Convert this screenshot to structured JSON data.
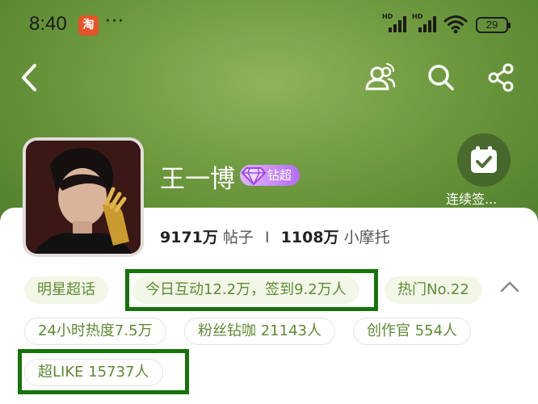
{
  "status_bar": {
    "time": "8:40",
    "app_badge": "淘",
    "more": "···",
    "signal_hd_1": "HD",
    "signal_hd_2": "HD",
    "battery": "29"
  },
  "nav": {
    "back_icon": "chevron-left-icon",
    "users_icon": "users-icon",
    "search_icon": "search-icon",
    "share_icon": "share-icon"
  },
  "profile": {
    "name": "王一博",
    "badge_label": "钻超",
    "checkin_label": "连续签...",
    "posts_count": "9171万",
    "posts_label": "帖子",
    "separator": "I",
    "fans_count": "1108万",
    "fans_label": "小摩托"
  },
  "tags": {
    "row1": [
      "明星超话",
      "今日互动12.2万，签到9.2万人",
      "热门No.22"
    ],
    "row2": [
      "24小时热度7.5万",
      "粉丝钻咖 21143人",
      "创作官 554人"
    ],
    "row3": [
      "超LIKE 15737人"
    ]
  },
  "colors": {
    "header_green": "#6f9a3f",
    "tag_text": "#5f8a33",
    "tag_bg": "#f2f7e8",
    "highlight": "#16730a"
  }
}
